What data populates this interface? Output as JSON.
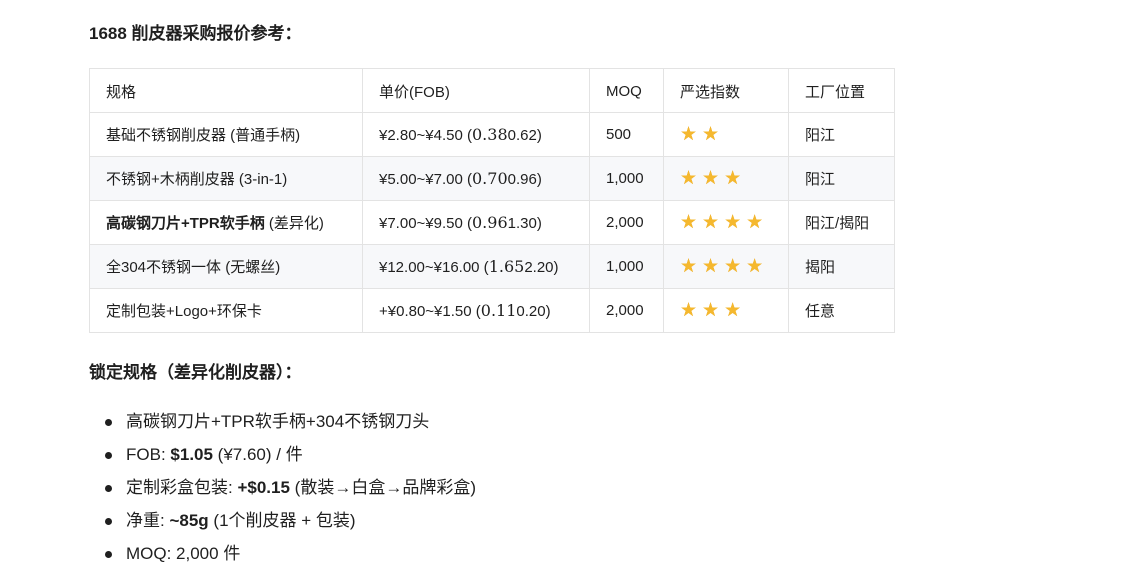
{
  "title": "1688 削皮器采购报价参考：",
  "table": {
    "headers": {
      "spec": "规格",
      "price": "单价(FOB)",
      "moq": "MOQ",
      "rating": "严选指数",
      "location": "工厂位置"
    },
    "rows": [
      {
        "spec_bold": "",
        "spec": "基础不锈钢削皮器 (普通手柄)",
        "price_prefix": "¥2.80~¥4.50 (",
        "price_serif": "0.38",
        "price_suffix": "0.62)",
        "moq": "500",
        "stars": 2,
        "location": "阳江"
      },
      {
        "spec_bold": "",
        "spec": "不锈钢+木柄削皮器 (3-in-1)",
        "price_prefix": "¥5.00~¥7.00 (",
        "price_serif": "0.70",
        "price_suffix": "0.96)",
        "moq": "1,000",
        "stars": 3,
        "location": "阳江"
      },
      {
        "spec_bold": "高碳钢刀片+TPR软手柄",
        "spec": " (差异化)",
        "price_prefix": "¥7.00~¥9.50 (",
        "price_serif": "0.96",
        "price_suffix": "1.30)",
        "moq": "2,000",
        "stars": 4,
        "location": "阳江/揭阳"
      },
      {
        "spec_bold": "",
        "spec": "全304不锈钢一体 (无螺丝)",
        "price_prefix": "¥12.00~¥16.00 (",
        "price_serif": "1.65",
        "price_suffix": "2.20)",
        "moq": "1,000",
        "stars": 4,
        "location": "揭阳"
      },
      {
        "spec_bold": "",
        "spec": "定制包装+Logo+环保卡",
        "price_prefix": "+¥0.80~¥1.50 (",
        "price_serif": "0.11",
        "price_suffix": "0.20)",
        "moq": "2,000",
        "stars": 3,
        "location": "任意"
      }
    ]
  },
  "lock_title": "锁定规格（差异化削皮器）：",
  "spec_list": [
    {
      "label": "高碳钢刀片+TPR软手柄+304不锈钢刀头",
      "value": "",
      "note": ""
    },
    {
      "label": "FOB: ",
      "value": "$1.05",
      "note": " (¥7.60) / 件"
    },
    {
      "label": "定制彩盒包装: ",
      "value": "+$0.15",
      "note": " (散装→白盒→品牌彩盒)"
    },
    {
      "label": "净重: ",
      "value": "~85g",
      "note": " (1个削皮器 + 包装)"
    },
    {
      "label": "MOQ: 2,000 件",
      "value": "",
      "note": ""
    }
  ],
  "icons": {
    "star": "star-icon",
    "bullet": "bullet-icon"
  },
  "colors": {
    "star": "#f5b82e",
    "row_alt": "#f7f8fa",
    "border": "#e3e3e3",
    "text": "#1f1f1f"
  }
}
